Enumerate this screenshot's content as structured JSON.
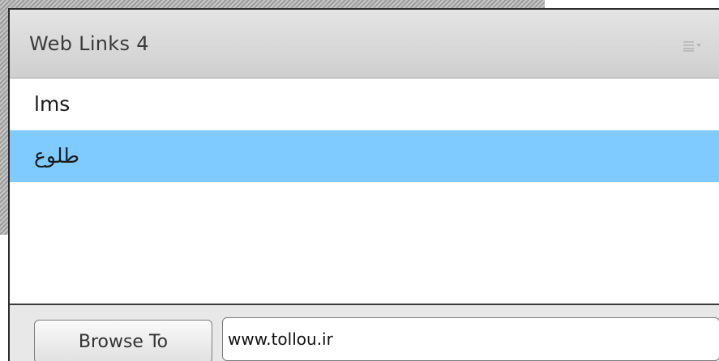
{
  "pod": {
    "title": "Web Links 4",
    "options_icon": "hamburger-menu-dropdown-icon"
  },
  "links": [
    {
      "label": "lms",
      "selected": false
    },
    {
      "label": "طلوع",
      "selected": true
    }
  ],
  "footer": {
    "browse_label": "Browse To",
    "url_value": "www.tollou.ir"
  },
  "colors": {
    "selection": "#7fcbff",
    "titlebar": "#d8d8d8",
    "footer": "#e8e8e8"
  }
}
